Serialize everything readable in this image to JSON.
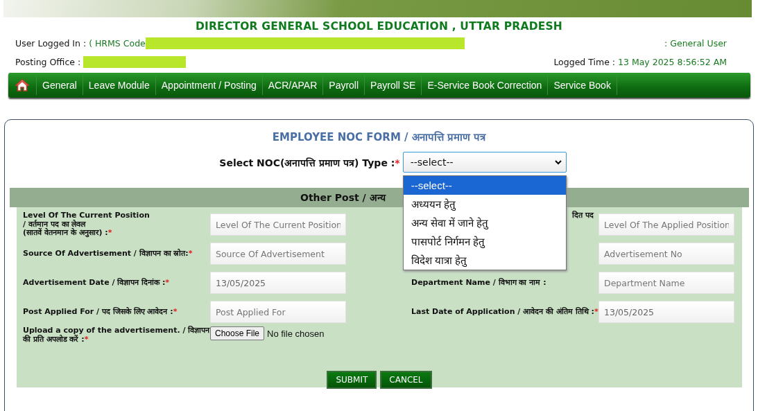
{
  "header": {
    "title": "DIRECTOR GENERAL SCHOOL EDUCATION , UTTAR PRADESH",
    "user_label": "User Logged In :",
    "user_value": "( HRMS Code",
    "role": ": General User",
    "office_label": "Posting Office :",
    "time_label": "Logged Time :",
    "time_value": "13 May 2025 8:56:52 AM"
  },
  "nav": {
    "items": [
      {
        "label": "General"
      },
      {
        "label": "Leave Module"
      },
      {
        "label": "Appointment / Posting"
      },
      {
        "label": "ACR/APAR"
      },
      {
        "label": "Payroll"
      },
      {
        "label": "Payroll SE"
      },
      {
        "label": "E-Service Book Correction"
      },
      {
        "label": "Service Book"
      }
    ]
  },
  "form": {
    "title": "EMPLOYEE NOC FORM / अनापत्ति प्रमाण पत्र",
    "select_label": "Select NOC(अनापत्ति प्रमाण पत्र) Type :",
    "required_mark": "*",
    "select_value": "--select--",
    "options": [
      {
        "label": "--select--",
        "selected": true
      },
      {
        "label": "अध्ययन हेतु",
        "selected": false
      },
      {
        "label": "अन्य सेवा में जाने हेतु",
        "selected": false
      },
      {
        "label": "पासपोर्ट निर्गमन हेतु",
        "selected": false
      },
      {
        "label": "विदेश यात्रा हेतु",
        "selected": false
      }
    ],
    "section_title": "Other Post / अन्य",
    "rows": [
      {
        "left": {
          "label": "Level Of The Current Position\n/ वर्तमान पद का लेवल\n(सातवें वेतनमान के अनुसार) :",
          "required": true,
          "placeholder": "Level Of The Current Position"
        },
        "right": {
          "label": "दित पद",
          "placeholder": "Level Of The Applied Position"
        }
      },
      {
        "left": {
          "label": "Source Of Advertisement / विज्ञापन का स्रोत:",
          "required": true,
          "placeholder": "Source Of Advertisement"
        },
        "right": {
          "placeholder": "Advertisement No"
        }
      },
      {
        "left": {
          "label": "Advertisement Date / विज्ञापन दिनांक :",
          "required": true,
          "value": "13/05/2025"
        },
        "right": {
          "label": "Department Name / विभाग का नाम :",
          "placeholder": "Department Name"
        }
      },
      {
        "left": {
          "label": "Post Applied For / पद जिसके लिए आवेदन :",
          "required": true,
          "placeholder": "Post Applied For"
        },
        "right": {
          "label": "Last Date of Application / आवेदन की अंतिम तिथि :",
          "required": true,
          "value": "13/05/2025"
        }
      }
    ],
    "upload": {
      "label": "Upload a copy of the advertisement. / विज्ञापन की प्रति अपलोड करें :",
      "required_mark": "*",
      "button": "Choose File",
      "status": "No file chosen"
    },
    "buttons": [
      "SUBMIT",
      "CANCEL"
    ]
  }
}
